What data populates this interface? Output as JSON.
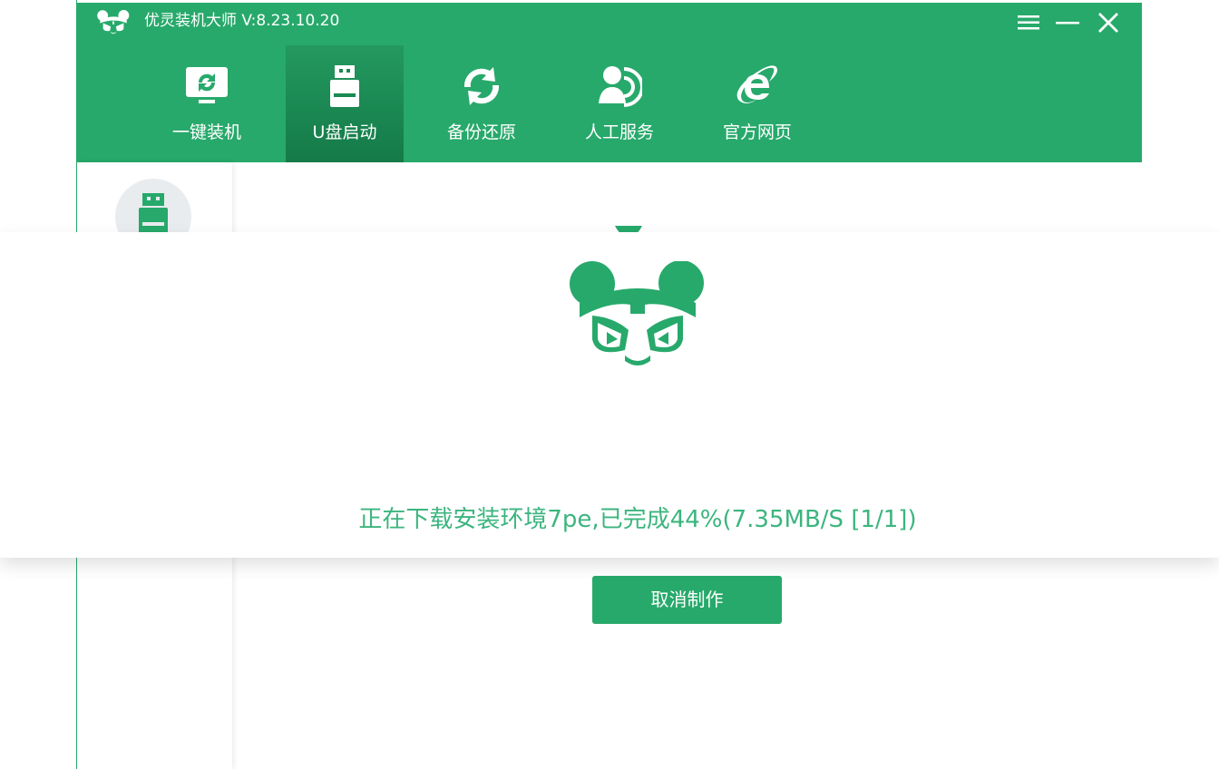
{
  "window": {
    "title": "优灵装机大师 V:8.23.10.20",
    "controls": {
      "menu": "menu-icon",
      "minimize": "minimize-icon",
      "close": "close-icon"
    }
  },
  "nav": {
    "items": [
      {
        "label": "一键装机",
        "icon": "monitor-refresh-icon",
        "active": false
      },
      {
        "label": "U盘启动",
        "icon": "usb-drive-icon",
        "active": true
      },
      {
        "label": "备份还原",
        "icon": "backup-restore-icon",
        "active": false
      },
      {
        "label": "人工服务",
        "icon": "customer-service-icon",
        "active": false
      },
      {
        "label": "官方网页",
        "icon": "internet-explorer-icon",
        "active": false
      }
    ]
  },
  "sidebar": {
    "items": [
      {
        "icon": "usb-drive-icon"
      }
    ]
  },
  "progress": {
    "message": "正在下载安装环境7pe,已完成44%(7.35MB/S [1/1])",
    "percent": 44
  },
  "actions": {
    "cancel_label": "取消制作"
  },
  "colors": {
    "brand_green": "#27a96b",
    "status_text": "#3cb57e",
    "top_strip": "#2aa8e0"
  }
}
